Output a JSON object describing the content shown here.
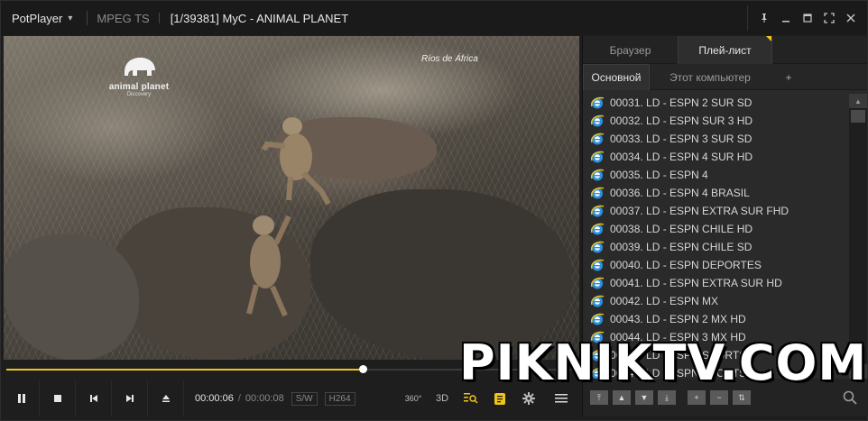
{
  "titlebar": {
    "app_name": "PotPlayer",
    "format": "MPEG TS",
    "title": "[1/39381] MyC - ANIMAL PLANET"
  },
  "video": {
    "logo_name": "animal planet",
    "logo_sub": "Discovery",
    "corner_text": "Ríos de África"
  },
  "playback": {
    "progress": 0.625,
    "current_time": "00:00:06",
    "total_time": "00:00:08",
    "sw_label": "S/W",
    "codec": "H264",
    "btn_360": "360°",
    "btn_3d": "3D"
  },
  "panel": {
    "tabs": [
      "Браузер",
      "Плей-лист"
    ],
    "subtabs": [
      "Основной",
      "Этот компьютер",
      "+"
    ],
    "items": [
      "00031. LD - ESPN 2 SUR SD",
      "00032. LD - ESPN SUR 3 HD",
      "00033. LD - ESPN 3 SUR SD",
      "00034. LD - ESPN 4 SUR HD",
      "00035. LD - ESPN 4",
      "00036. LD - ESPN 4 BRASIL",
      "00037. LD - ESPN EXTRA SUR FHD",
      "00038. LD - ESPN CHILE HD",
      "00039. LD - ESPN CHILE SD",
      "00040. LD - ESPN DEPORTES",
      "00041. LD - ESPN EXTRA SUR HD",
      "00042. LD - ESPN MX",
      "00043. LD - ESPN 2 MX HD",
      "00044. LD - ESPN 3 MX HD",
      "00045. LD - ESPN SPORTS 1",
      "00046. LD - ESPN SPORTS 2"
    ]
  },
  "overlay": {
    "site": "PIKNIKTV.COM"
  },
  "colors": {
    "accent": "#f0c419",
    "background": "#1e1e1e",
    "panel": "#2a2a2a"
  }
}
